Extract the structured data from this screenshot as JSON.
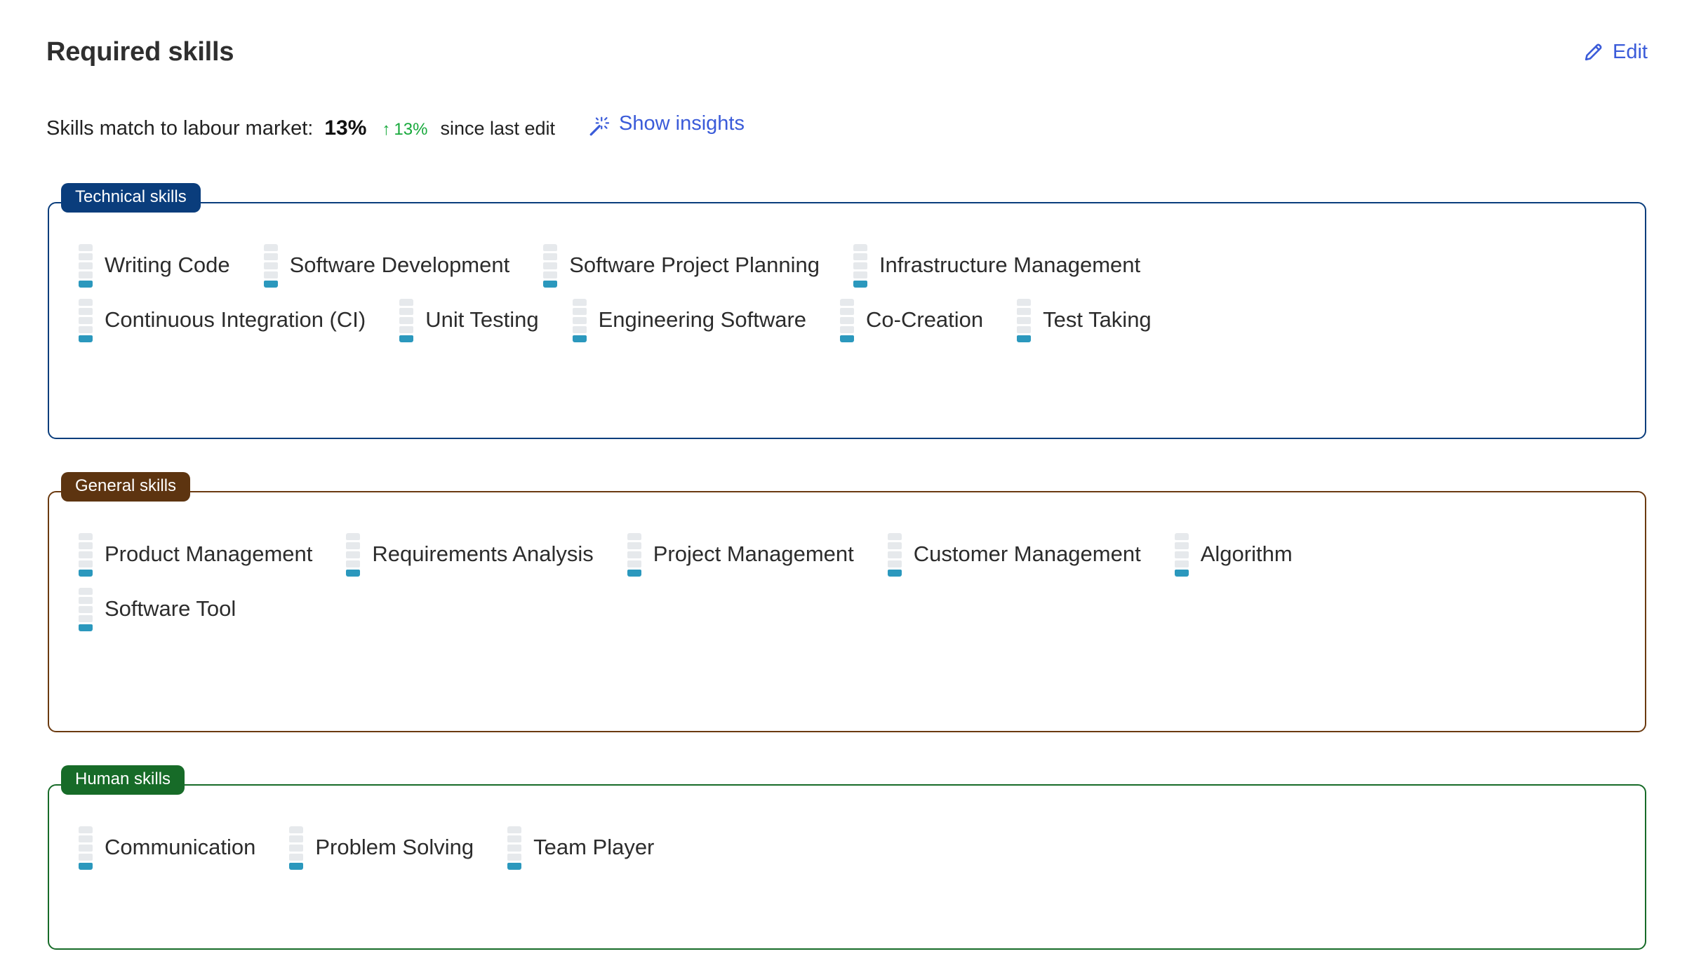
{
  "header": {
    "title": "Required skills",
    "edit_label": "Edit",
    "edit_icon": "pencil-icon"
  },
  "match": {
    "label": "Skills match to labour market:",
    "value": "13%",
    "delta_arrow": "↑",
    "delta_value": "13%",
    "since_text": "since last edit",
    "insights_label": "Show insights",
    "insights_icon": "magic-wand-icon"
  },
  "colors": {
    "technical": "#0a3d7c",
    "general": "#5d3410",
    "human": "#176b28",
    "link": "#3a5bd9",
    "delta_positive": "#18a93c",
    "meter_filled": "#2b98bd",
    "meter_empty": "#e6e9ec"
  },
  "groups": [
    {
      "id": "technical-skills",
      "legend": "Technical skills",
      "rows": [
        [
          {
            "label": "Writing Code",
            "level": 1,
            "max_level": 5
          },
          {
            "label": "Software Development",
            "level": 1,
            "max_level": 5
          },
          {
            "label": "Software Project Planning",
            "level": 1,
            "max_level": 5
          },
          {
            "label": "Infrastructure Management",
            "level": 1,
            "max_level": 5
          }
        ],
        [
          {
            "label": "Continuous Integration (CI)",
            "level": 1,
            "max_level": 5
          },
          {
            "label": "Unit Testing",
            "level": 1,
            "max_level": 5
          },
          {
            "label": "Engineering Software",
            "level": 1,
            "max_level": 5
          },
          {
            "label": "Co-Creation",
            "level": 1,
            "max_level": 5
          },
          {
            "label": "Test Taking",
            "level": 1,
            "max_level": 5
          }
        ]
      ]
    },
    {
      "id": "general-skills",
      "legend": "General skills",
      "rows": [
        [
          {
            "label": "Product Management",
            "level": 1,
            "max_level": 5
          },
          {
            "label": "Requirements Analysis",
            "level": 1,
            "max_level": 5
          },
          {
            "label": "Project Management",
            "level": 1,
            "max_level": 5
          },
          {
            "label": "Customer Management",
            "level": 1,
            "max_level": 5
          },
          {
            "label": "Algorithm",
            "level": 1,
            "max_level": 5
          }
        ],
        [
          {
            "label": "Software Tool",
            "level": 1,
            "max_level": 5
          }
        ]
      ]
    },
    {
      "id": "human-skills",
      "legend": "Human skills",
      "rows": [
        [
          {
            "label": "Communication",
            "level": 1,
            "max_level": 5
          },
          {
            "label": "Problem Solving",
            "level": 1,
            "max_level": 5
          },
          {
            "label": "Team Player",
            "level": 1,
            "max_level": 5
          }
        ]
      ]
    }
  ]
}
